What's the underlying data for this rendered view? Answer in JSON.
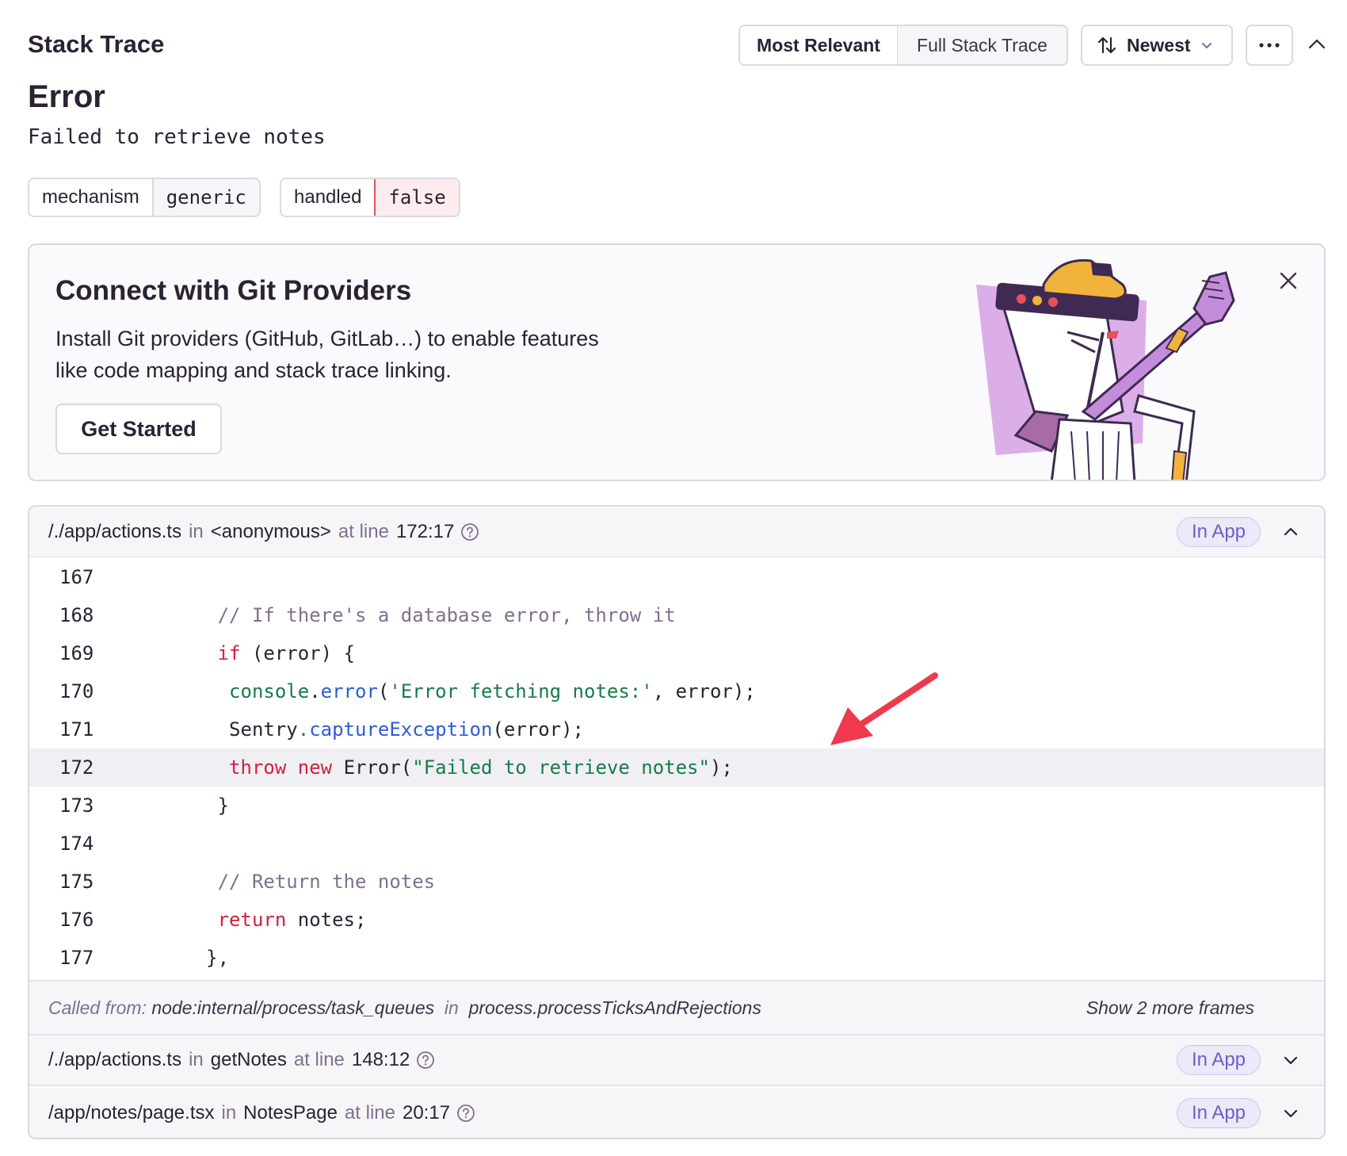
{
  "header": {
    "title": "Stack Trace",
    "view_tabs": [
      "Most Relevant",
      "Full Stack Trace"
    ],
    "sort_label": "Newest"
  },
  "error": {
    "type": "Error",
    "message": "Failed to retrieve notes",
    "tags": [
      {
        "key": "mechanism",
        "value": "generic"
      },
      {
        "key": "handled",
        "value": "false"
      }
    ]
  },
  "banner": {
    "title": "Connect with Git Providers",
    "description": "Install Git providers (GitHub, GitLab…) to enable features like code mapping and stack trace linking.",
    "button": "Get Started"
  },
  "frames": [
    {
      "file": "/./app/actions.ts",
      "in": "in",
      "func": "<anonymous>",
      "at": "at line",
      "loc": "172:17",
      "badge": "In App"
    },
    {
      "file": "/./app/actions.ts",
      "in": "in",
      "func": "getNotes",
      "at": "at line",
      "loc": "148:12",
      "badge": "In App"
    },
    {
      "file": "/app/notes/page.tsx",
      "in": "in",
      "func": "NotesPage",
      "at": "at line",
      "loc": "20:17",
      "badge": "In App"
    }
  ],
  "code_lines": [
    {
      "n": "167"
    },
    {
      "n": "168",
      "comment": "// If there's a database error, throw it"
    },
    {
      "n": "169",
      "kw": "if",
      "rest": " (error) {"
    },
    {
      "n": "170",
      "obj": "console",
      "dot": ".",
      "method": "error",
      "open": "(",
      "str": "'Error fetching notes:'",
      "rest": ", error);"
    },
    {
      "n": "171",
      "obj": "Sentry",
      "dot": ".",
      "method": "captureException",
      "rest": "(error);"
    },
    {
      "n": "172",
      "kw1": "throw",
      "kw2": "new",
      "cls": "Error(",
      "str": "\"Failed to retrieve notes\"",
      "rest": ");"
    },
    {
      "n": "173",
      "rest": "}"
    },
    {
      "n": "174"
    },
    {
      "n": "175",
      "comment": "// Return the notes"
    },
    {
      "n": "176",
      "kw": "return",
      "rest": " notes;"
    },
    {
      "n": "177",
      "rest": "},"
    }
  ],
  "called_from": {
    "label": "Called from:",
    "module": "node:internal/process/task_queues",
    "in": "in",
    "func": "process.processTicksAndRejections",
    "more": "Show 2 more frames"
  },
  "colors": {
    "accent": "#6c5fc7",
    "error_red": "#e8505b",
    "arrow": "#f0394d"
  }
}
